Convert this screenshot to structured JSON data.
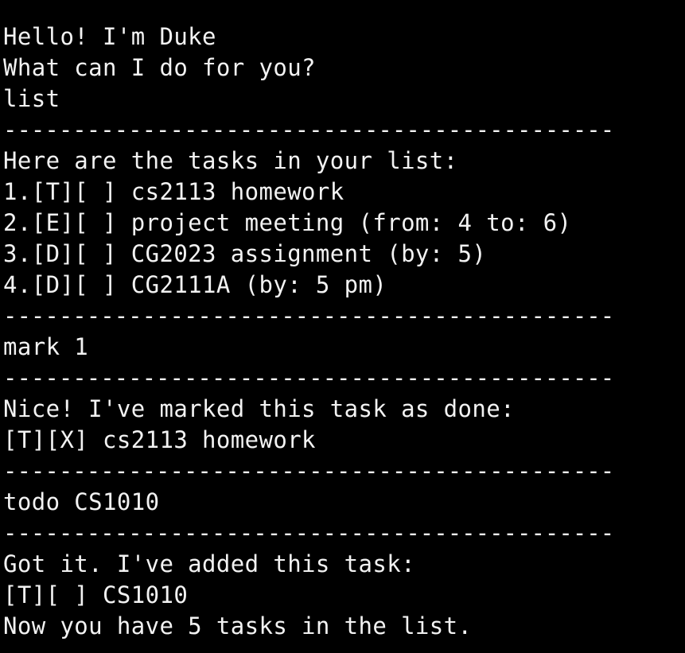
{
  "terminal": {
    "colors": {
      "background": "#000000",
      "foreground": "#f2f2f2"
    },
    "lines": [
      "",
      "Hello! I'm Duke",
      "What can I do for you?",
      "list",
      "--------------------------------------------",
      "Here are the tasks in your list:",
      "1.[T][ ] cs2113 homework",
      "2.[E][ ] project meeting (from: 4 to: 6)",
      "3.[D][ ] CG2023 assignment (by: 5)",
      "4.[D][ ] CG2111A (by: 5 pm)",
      "--------------------------------------------",
      "mark 1",
      "--------------------------------------------",
      "Nice! I've marked this task as done:",
      "[T][X] cs2113 homework",
      "--------------------------------------------",
      "todo CS1010",
      "--------------------------------------------",
      "Got it. I've added this task:",
      "[T][ ] CS1010",
      "Now you have 5 tasks in the list.",
      "--------------------------------------------"
    ]
  }
}
